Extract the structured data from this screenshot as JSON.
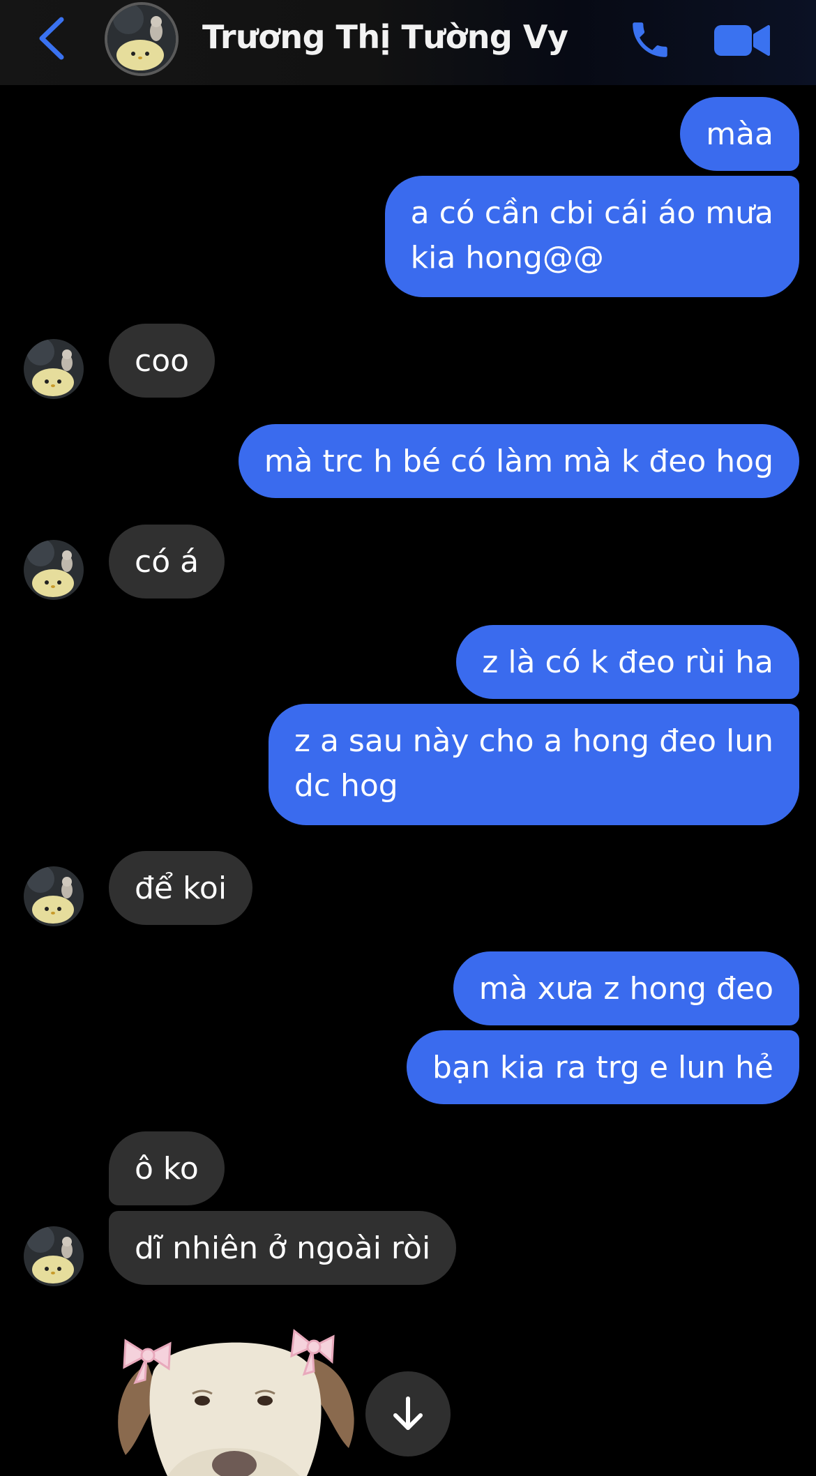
{
  "header": {
    "back_icon": "chevron-left-icon",
    "contact_name": "Trương Thị Tường Vy",
    "call_icon": "phone-icon",
    "video_icon": "video-camera-icon"
  },
  "colors": {
    "accent": "#3a6bee",
    "outgoing_bubble": "#3a6bee",
    "incoming_bubble": "#303030",
    "background": "#000000"
  },
  "messages": [
    {
      "from": "me",
      "text": "màa"
    },
    {
      "from": "me",
      "text": "a có cần cbi cái áo mưa\nkia hong@@"
    },
    {
      "from": "contact",
      "text": "coo"
    },
    {
      "from": "me",
      "text": "mà trc h bé có làm mà k đeo hog"
    },
    {
      "from": "contact",
      "text": "có á"
    },
    {
      "from": "me",
      "text": "z là có k đeo rùi ha"
    },
    {
      "from": "me",
      "text": "z a sau này cho a hong đeo lun\ndc hog"
    },
    {
      "from": "contact",
      "text": "để koi"
    },
    {
      "from": "me",
      "text": "mà xưa z hong đeo"
    },
    {
      "from": "me",
      "text": "bạn kia ra trg e lun hẻ"
    },
    {
      "from": "contact",
      "text": "ô ko"
    },
    {
      "from": "contact",
      "text": "dĩ nhiên ở ngoài ròi"
    }
  ],
  "sticker": {
    "icon": "dog-with-bows-sticker"
  },
  "scroll_down": {
    "icon": "arrow-down-icon"
  }
}
